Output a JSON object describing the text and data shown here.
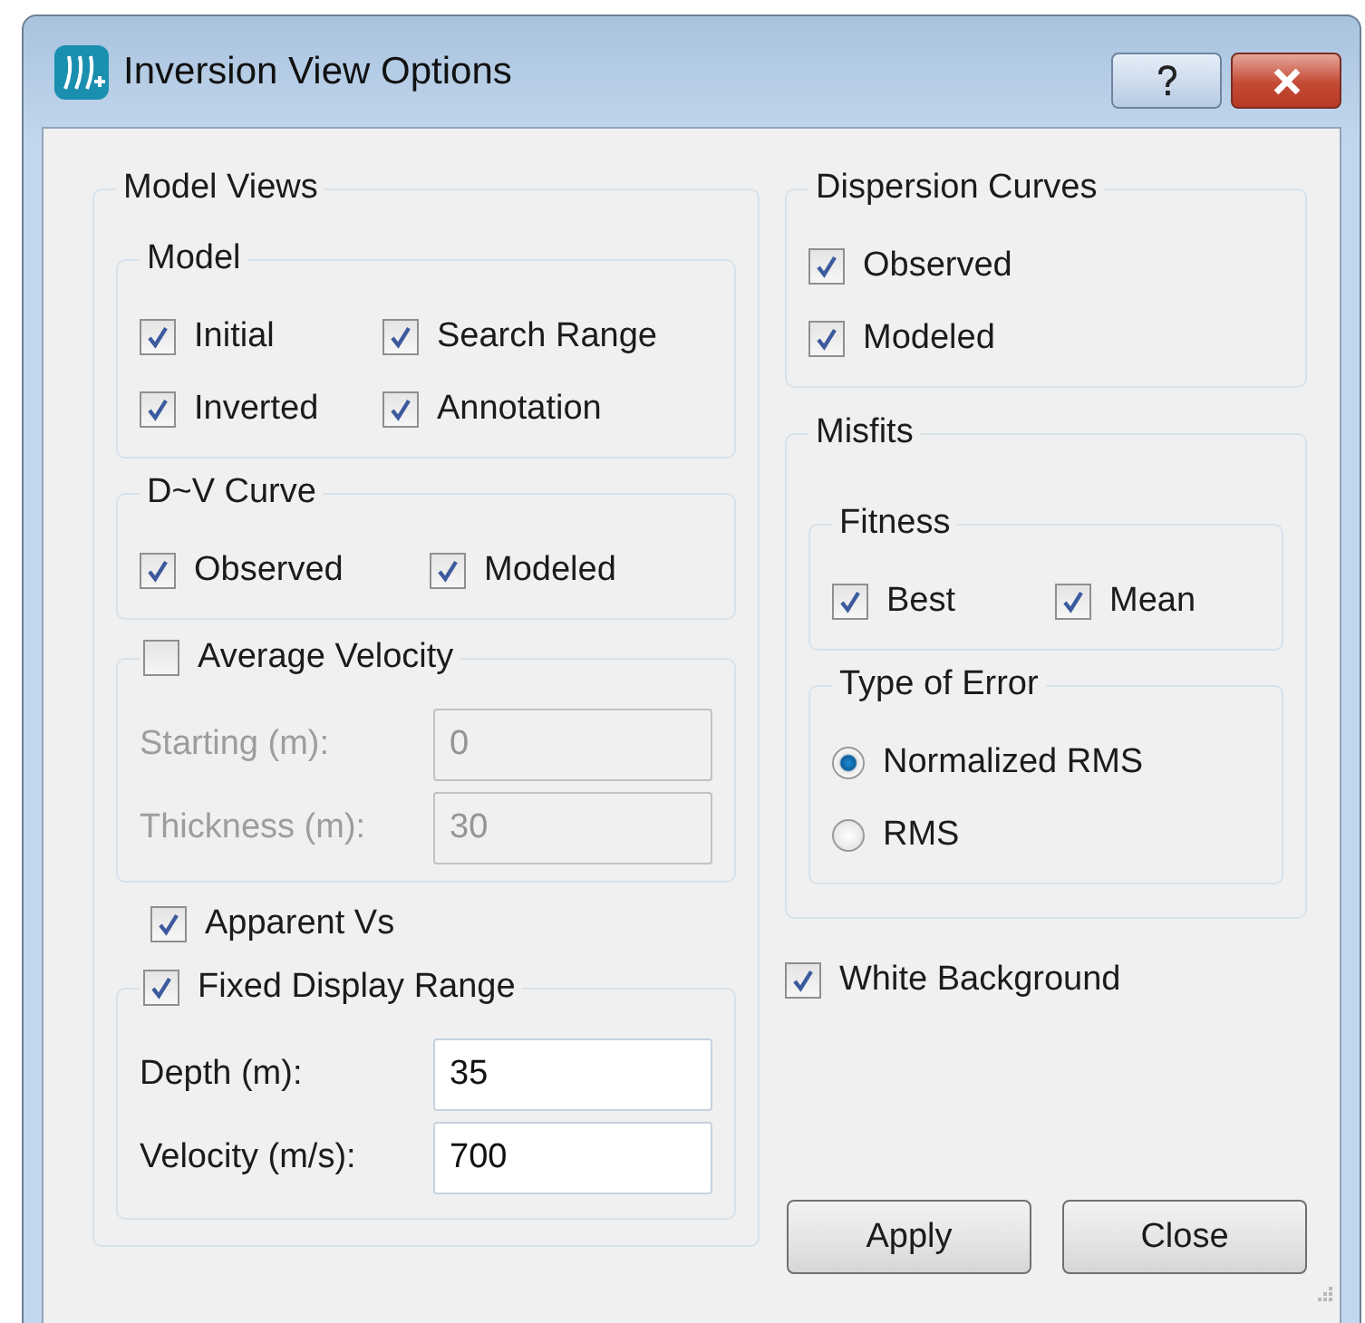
{
  "window": {
    "title": "Inversion View Options"
  },
  "model_views": {
    "title": "Model Views",
    "model": {
      "title": "Model",
      "options": [
        {
          "label": "Initial",
          "checked": true
        },
        {
          "label": "Search Range",
          "checked": true
        },
        {
          "label": "Inverted",
          "checked": true
        },
        {
          "label": "Annotation",
          "checked": true
        }
      ]
    },
    "dv_curve": {
      "title": "D~V Curve",
      "options": [
        {
          "label": "Observed",
          "checked": true
        },
        {
          "label": "Modeled",
          "checked": true
        }
      ]
    },
    "average_velocity": {
      "label": "Average Velocity",
      "checked": false,
      "fields": [
        {
          "label": "Starting (m):",
          "value": "0",
          "disabled": true
        },
        {
          "label": "Thickness (m):",
          "value": "30",
          "disabled": true
        }
      ]
    },
    "apparent_vs": {
      "label": "Apparent Vs",
      "checked": true
    },
    "fixed_display_range": {
      "label": "Fixed Display Range",
      "checked": true,
      "fields": [
        {
          "label": "Depth (m):",
          "value": "35",
          "disabled": false
        },
        {
          "label": "Velocity (m/s):",
          "value": "700",
          "disabled": false
        }
      ]
    }
  },
  "dispersion_curves": {
    "title": "Dispersion Curves",
    "options": [
      {
        "label": "Observed",
        "checked": true
      },
      {
        "label": "Modeled",
        "checked": true
      }
    ]
  },
  "misfits": {
    "title": "Misfits",
    "fitness": {
      "title": "Fitness",
      "options": [
        {
          "label": "Best",
          "checked": true
        },
        {
          "label": "Mean",
          "checked": true
        }
      ]
    },
    "type_of_error": {
      "title": "Type of Error",
      "options": [
        {
          "label": "Normalized RMS",
          "selected": true
        },
        {
          "label": "RMS",
          "selected": false
        }
      ]
    }
  },
  "white_background": {
    "label": "White Background",
    "checked": true
  },
  "buttons": [
    "Apply",
    "Close"
  ]
}
